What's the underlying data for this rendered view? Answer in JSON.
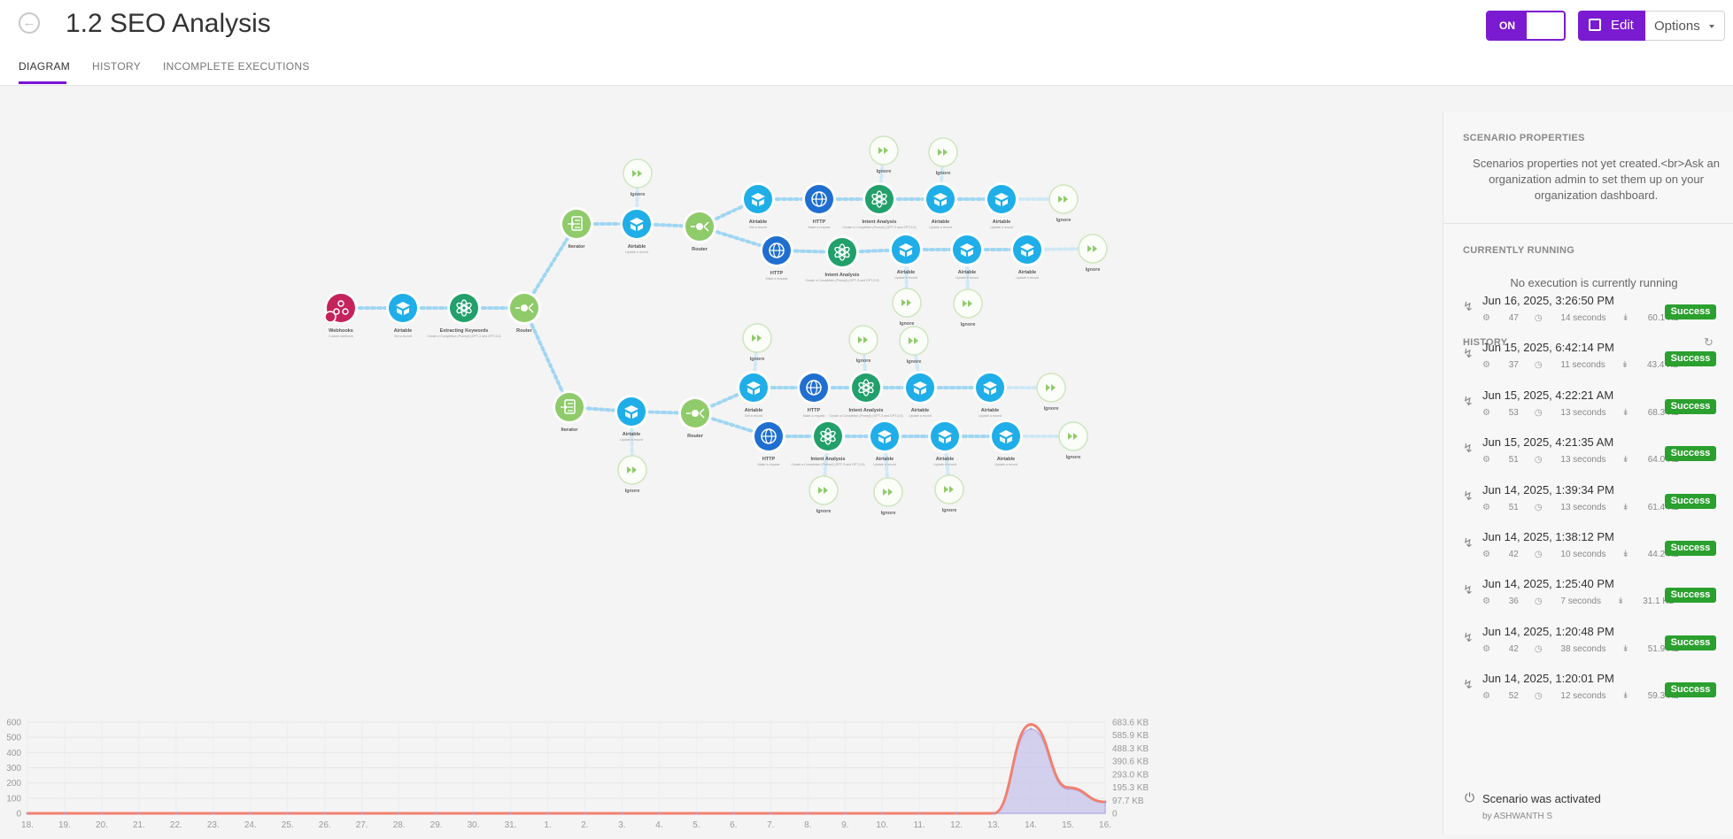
{
  "header": {
    "back_icon": "back-arrow-circle-icon",
    "title": "1.2 SEO Analysis",
    "toggle_label": "ON",
    "edit_label": "Edit",
    "options_label": "Options"
  },
  "tabs": [
    {
      "label": "DIAGRAM",
      "active": true
    },
    {
      "label": "HISTORY",
      "active": false
    },
    {
      "label": "INCOMPLETE EXECUTIONS",
      "active": false
    }
  ],
  "colors": {
    "accent": "#7a1bd1",
    "success": "#2ba02f",
    "airtable": "#1faee8",
    "http": "#1f6fd0",
    "openai": "#22a06b",
    "router": "#8fcb6a",
    "webhooks": "#c4245b",
    "ignore": "#8fcb6a",
    "ops_line": "#f08070",
    "transfer_fill": "#c8c4ec"
  },
  "diagram": {
    "nodes": [
      {
        "label": "Webhooks",
        "sub": "Custom webhook",
        "type": "webhooks"
      },
      {
        "label": "Airtable",
        "sub": "Get a record",
        "type": "airtable"
      },
      {
        "label": "Extracting Keywords",
        "sub": "Create a Completion (Prompt) (GPT-3 and GPT-3.5)",
        "type": "openai"
      },
      {
        "label": "Router",
        "sub": "",
        "type": "router"
      },
      {
        "label": "Iterator",
        "sub": "",
        "type": "iterator"
      },
      {
        "label": "Airtable",
        "sub": "Update a record",
        "type": "airtable"
      },
      {
        "label": "Router",
        "sub": "",
        "type": "router"
      },
      {
        "label": "Ignore",
        "sub": "",
        "type": "ignore"
      },
      {
        "label": "Airtable",
        "sub": "Get a record",
        "type": "airtable"
      },
      {
        "label": "HTTP",
        "sub": "Make a request",
        "type": "http"
      },
      {
        "label": "Intent Analysis",
        "sub": "Create a Completion (Prompt) (GPT-3 and GPT-3.5)",
        "type": "openai"
      },
      {
        "label": "Airtable",
        "sub": "Update a record",
        "type": "airtable"
      },
      {
        "label": "Airtable",
        "sub": "Update a record",
        "type": "airtable"
      },
      {
        "label": "Ignore",
        "sub": "",
        "type": "ignore"
      },
      {
        "label": "Ignore",
        "sub": "",
        "type": "ignore"
      },
      {
        "label": "Ignore",
        "sub": "",
        "type": "ignore"
      },
      {
        "label": "HTTP",
        "sub": "Make a request",
        "type": "http"
      },
      {
        "label": "Intent Analysis",
        "sub": "Create a Completion (Prompt) (GPT-3 and GPT-3.5)",
        "type": "openai"
      },
      {
        "label": "Airtable",
        "sub": "Update a record",
        "type": "airtable"
      },
      {
        "label": "Airtable",
        "sub": "Update a record",
        "type": "airtable"
      },
      {
        "label": "Airtable",
        "sub": "Update a record",
        "type": "airtable"
      },
      {
        "label": "Ignore",
        "sub": "",
        "type": "ignore"
      },
      {
        "label": "Ignore",
        "sub": "",
        "type": "ignore"
      },
      {
        "label": "Ignore",
        "sub": "",
        "type": "ignore"
      },
      {
        "label": "Iterator",
        "sub": "",
        "type": "iterator"
      },
      {
        "label": "Airtable",
        "sub": "Update a record",
        "type": "airtable"
      },
      {
        "label": "Ignore",
        "sub": "",
        "type": "ignore"
      },
      {
        "label": "Router",
        "sub": "",
        "type": "router"
      },
      {
        "label": "Airtable",
        "sub": "Get a record",
        "type": "airtable"
      },
      {
        "label": "HTTP",
        "sub": "Make a request",
        "type": "http"
      },
      {
        "label": "Intent Analysis",
        "sub": "Create a Completion (Prompt) (GPT-3 and GPT-3.5)",
        "type": "openai"
      },
      {
        "label": "Airtable",
        "sub": "Update a record",
        "type": "airtable"
      },
      {
        "label": "Airtable",
        "sub": "Update a record",
        "type": "airtable"
      },
      {
        "label": "Ignore",
        "sub": "",
        "type": "ignore"
      },
      {
        "label": "Ignore",
        "sub": "",
        "type": "ignore"
      },
      {
        "label": "Ignore",
        "sub": "",
        "type": "ignore"
      },
      {
        "label": "Ignore",
        "sub": "",
        "type": "ignore"
      },
      {
        "label": "HTTP",
        "sub": "Make a request",
        "type": "http"
      },
      {
        "label": "Intent Analysis",
        "sub": "Create a Completion (Prompt) (GPT-3 and GPT-3.5)",
        "type": "openai"
      },
      {
        "label": "Airtable",
        "sub": "Update a record",
        "type": "airtable"
      },
      {
        "label": "Airtable",
        "sub": "Update a record",
        "type": "airtable"
      },
      {
        "label": "Airtable",
        "sub": "Update a record",
        "type": "airtable"
      },
      {
        "label": "Ignore",
        "sub": "",
        "type": "ignore"
      },
      {
        "label": "Ignore",
        "sub": "",
        "type": "ignore"
      },
      {
        "label": "Ignore",
        "sub": "",
        "type": "ignore"
      },
      {
        "label": "Ignore",
        "sub": "",
        "type": "ignore"
      }
    ],
    "edges": [
      [
        0,
        1
      ],
      [
        1,
        2
      ],
      [
        2,
        3
      ],
      [
        3,
        4
      ],
      [
        4,
        5
      ],
      [
        5,
        6
      ],
      [
        7,
        5
      ],
      [
        6,
        8
      ],
      [
        8,
        9
      ],
      [
        9,
        10
      ],
      [
        10,
        11
      ],
      [
        11,
        12
      ],
      [
        12,
        13
      ],
      [
        14,
        10
      ],
      [
        15,
        11
      ],
      [
        6,
        16
      ],
      [
        16,
        17
      ],
      [
        17,
        18
      ],
      [
        18,
        19
      ],
      [
        19,
        20
      ],
      [
        20,
        21
      ],
      [
        18,
        22
      ],
      [
        19,
        23
      ],
      [
        3,
        24
      ],
      [
        24,
        25
      ],
      [
        25,
        26
      ],
      [
        25,
        27
      ],
      [
        27,
        28
      ],
      [
        28,
        29
      ],
      [
        29,
        30
      ],
      [
        30,
        31
      ],
      [
        31,
        32
      ],
      [
        32,
        33
      ],
      [
        34,
        28
      ],
      [
        35,
        30
      ],
      [
        36,
        31
      ],
      [
        27,
        37
      ],
      [
        37,
        38
      ],
      [
        38,
        39
      ],
      [
        39,
        40
      ],
      [
        40,
        41
      ],
      [
        41,
        42
      ],
      [
        38,
        43
      ],
      [
        39,
        44
      ],
      [
        40,
        45
      ]
    ]
  },
  "sidebar": {
    "properties_heading": "SCENARIO PROPERTIES",
    "properties_text": "Scenarios properties not yet created.<br>Ask an organization admin to set them up on your organization dashboard.",
    "running_heading": "CURRENTLY RUNNING",
    "running_text": "No execution is currently running",
    "history_heading": "HISTORY",
    "refresh_icon": "refresh-icon",
    "history": [
      {
        "datetime": "Jun 16, 2025, 3:26:50 PM",
        "ops": "47",
        "duration": "14 seconds",
        "size": "60.1 KB",
        "status": "Success"
      },
      {
        "datetime": "Jun 15, 2025, 6:42:14 PM",
        "ops": "37",
        "duration": "11 seconds",
        "size": "43.4 KB",
        "status": "Success"
      },
      {
        "datetime": "Jun 15, 2025, 4:22:21 AM",
        "ops": "53",
        "duration": "13 seconds",
        "size": "68.3 KB",
        "status": "Success"
      },
      {
        "datetime": "Jun 15, 2025, 4:21:35 AM",
        "ops": "51",
        "duration": "13 seconds",
        "size": "64.0 KB",
        "status": "Success"
      },
      {
        "datetime": "Jun 14, 2025, 1:39:34 PM",
        "ops": "51",
        "duration": "13 seconds",
        "size": "61.4 KB",
        "status": "Success"
      },
      {
        "datetime": "Jun 14, 2025, 1:38:12 PM",
        "ops": "42",
        "duration": "10 seconds",
        "size": "44.2 KB",
        "status": "Success"
      },
      {
        "datetime": "Jun 14, 2025, 1:25:40 PM",
        "ops": "36",
        "duration": "7 seconds",
        "size": "31.1 KB",
        "status": "Success"
      },
      {
        "datetime": "Jun 14, 2025, 1:20:48 PM",
        "ops": "42",
        "duration": "38 seconds",
        "size": "51.9 KB",
        "status": "Success"
      },
      {
        "datetime": "Jun 14, 2025, 1:20:01 PM",
        "ops": "52",
        "duration": "12 seconds",
        "size": "59.3 KB",
        "status": "Success"
      }
    ],
    "activated_text": "Scenario was activated",
    "activated_by": "by ASHWANTH S"
  },
  "chart_data": {
    "type": "area",
    "x": [
      "18.",
      "19.",
      "20.",
      "21.",
      "22.",
      "23.",
      "24.",
      "25.",
      "26.",
      "27.",
      "28.",
      "29.",
      "30.",
      "31.",
      "1.",
      "2.",
      "3.",
      "4.",
      "5.",
      "6.",
      "7.",
      "8.",
      "9.",
      "10.",
      "11.",
      "12.",
      "13.",
      "14.",
      "15.",
      "16."
    ],
    "ylim_left": [
      0,
      600
    ],
    "yticks_left": [
      "0",
      "100",
      "200",
      "300",
      "400",
      "500",
      "600"
    ],
    "yticks_right": [
      "0",
      "97.7 KB",
      "195.3 KB",
      "293.0 KB",
      "390.6 KB",
      "488.3 KB",
      "585.9 KB",
      "683.6 KB"
    ],
    "grid": true,
    "series": [
      {
        "axis": "left",
        "values": [
          0,
          0,
          0,
          0,
          0,
          0,
          0,
          0,
          0,
          0,
          0,
          0,
          0,
          0,
          0,
          0,
          0,
          0,
          0,
          0,
          0,
          0,
          0,
          0,
          0,
          0,
          0,
          585,
          170,
          75
        ]
      },
      {
        "axis": "right",
        "values": [
          0,
          0,
          0,
          0,
          0,
          0,
          0,
          0,
          0,
          0,
          0,
          0,
          0,
          0,
          0,
          0,
          0,
          0,
          0,
          0,
          0,
          0,
          0,
          0,
          0,
          0,
          0,
          555,
          160,
          70
        ]
      }
    ]
  }
}
